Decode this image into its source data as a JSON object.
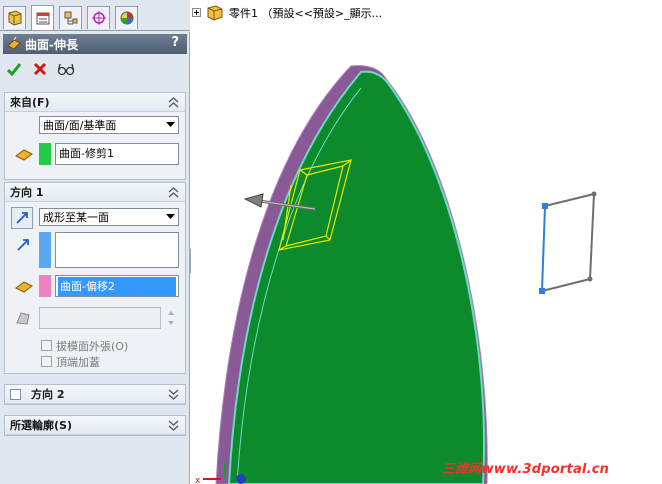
{
  "property_manager": {
    "tabs": [
      {
        "icon": "feature-manager-icon"
      },
      {
        "icon": "property-manager-icon"
      },
      {
        "icon": "configuration-manager-icon"
      },
      {
        "icon": "dimxpert-manager-icon"
      },
      {
        "icon": "display-manager-icon"
      }
    ],
    "title": "曲面-伸長",
    "help": "?",
    "ok_icon": "check-icon",
    "cancel_icon": "cross-icon",
    "preview_icon": "detailed-preview-icon",
    "from_group": {
      "title": "來自(F)",
      "start_condition": "曲面/面/基準面",
      "selected_surface": "曲面-修剪1",
      "surface_color": "#22cc44"
    },
    "direction1_group": {
      "title": "方向 1",
      "end_condition": "成形至某一面",
      "direction_value": "",
      "face_value": "曲面-偏移2",
      "direction_color": "#5aa9f0",
      "face_color": "#f080c0",
      "draft_value": "",
      "draft_outward_label": "拔模面外張(O)",
      "cap_end_label": "頂端加蓋"
    },
    "direction2_group": {
      "title": "方向 2"
    },
    "selected_contours_group": {
      "title": "所選輪廓(S)"
    }
  },
  "viewport": {
    "tree_label": "零件1 （預設<<預設>_顯示...",
    "watermark": "三维网www.3dportal.cn",
    "colors": {
      "surface_green": "#0d8a2c",
      "edge_cyan": "#6fd6c8",
      "back_surface": "#8a5a96",
      "preview_yellow": "#e6e600",
      "sketch_blue": "#2e7fd8",
      "sketch_gray": "#6e6e6e"
    }
  }
}
